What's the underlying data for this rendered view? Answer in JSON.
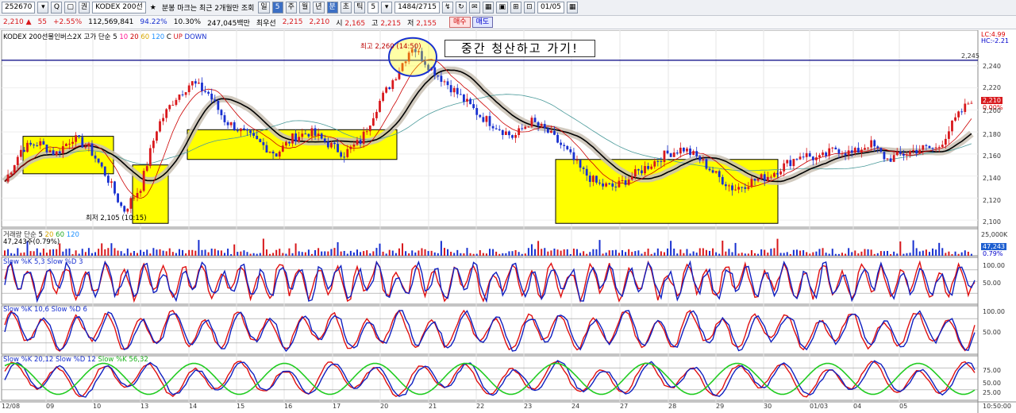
{
  "toolbar": {
    "code": "252670",
    "code_arrow": "▾",
    "search_glyph": "Q",
    "lock_glyph": "🔒",
    "flag": "권",
    "name": "KODEX 200선",
    "star": "★",
    "notice": "분봉 마크는 최근 2개월만 조회",
    "period_buttons": [
      "일",
      "5",
      "주",
      "월",
      "년",
      "분",
      "초",
      "틱"
    ],
    "interval_value": "5",
    "count": "1484/2715",
    "date": "01/05",
    "icon_buttons": [
      "↯",
      "↻",
      "✉",
      "▦",
      "▣",
      "⊞",
      "⊡"
    ]
  },
  "quote": {
    "price": "2,210",
    "arrow": "▲",
    "change": "55",
    "change_pct": "+2.55%",
    "volume": "112,569,841",
    "ratio1": "94.22%",
    "ratio2": "10.30%",
    "amount": "247,045백만",
    "best_ask_label": "최우선",
    "best_ask": "2,215",
    "best_bid": "2,210",
    "open_label": "시",
    "open": "2,165",
    "high_label": "고",
    "high": "2,215",
    "low_label": "저",
    "low": "2,155",
    "buy_label": "매수",
    "sell_label": "매도"
  },
  "main_panel": {
    "title": "KODEX 200선물인버스2X",
    "ma_legend_prefix": "고가 단순",
    "ma_periods": [
      "5",
      "10",
      "20",
      "60",
      "120"
    ],
    "ma_colors": [
      "#000000",
      "#ff1493",
      "#cc0000",
      "#d8a800",
      "#1e90ff"
    ],
    "extra_legend": [
      "C",
      "UP",
      "DOWN"
    ],
    "annotation_text": "중간 청산하고 가기!",
    "high_label": "최고 2,260 (14:50)",
    "low_label": "최저 2,105 (10:15)",
    "hline_value": "2,245",
    "current_price": "2,210",
    "current_pct": "0.00%",
    "lc_label": "LC:4.99",
    "hc_label": "HC:-2.21",
    "y_ticks": [
      "2,240",
      "2,220",
      "2,200",
      "2,180",
      "2,160",
      "2,140",
      "2,120",
      "2,100"
    ]
  },
  "volume_panel": {
    "title": "거래량 단순",
    "periods": [
      "5",
      "20",
      "60",
      "120"
    ],
    "value_label": "47,243주(0.79%)",
    "y_tick": "25,000K",
    "current": "47,243",
    "pct": "0.79%"
  },
  "stoch_panels": [
    {
      "title": "Slow %K 5,3  Slow %D 3",
      "ticks": [
        "100.00",
        "50.00"
      ]
    },
    {
      "title": "Slow %K 10,6  Slow %D 6",
      "ticks": [
        "100.00",
        "50.00"
      ]
    },
    {
      "title": "Slow %K 20,12  Slow %D 12",
      "extra": "Slow %K 56,32",
      "ticks": [
        "75.00",
        "50.00",
        "25.00"
      ]
    }
  ],
  "x_axis": [
    "12/08",
    "09",
    "10",
    "13",
    "14",
    "15",
    "16",
    "17",
    "20",
    "21",
    "22",
    "23",
    "24",
    "27",
    "28",
    "29",
    "30",
    "01/03",
    "04",
    "05"
  ],
  "time_label": "10:50:00",
  "colors": {
    "up": "#d8181c",
    "down": "#1830d0",
    "highlight": "#ffff00",
    "grid": "#cccccc",
    "hline": "#000080"
  },
  "chart_data": {
    "type": "candlestick",
    "x": [
      "12/08",
      "09",
      "10",
      "13",
      "14",
      "15",
      "16",
      "17",
      "20",
      "21",
      "22",
      "23",
      "24",
      "27",
      "28",
      "29",
      "30",
      "01/03",
      "04",
      "05"
    ],
    "close_path": [
      2135,
      2165,
      2170,
      2160,
      2175,
      2165,
      2140,
      2108,
      2130,
      2185,
      2210,
      2225,
      2215,
      2190,
      2180,
      2170,
      2160,
      2175,
      2180,
      2170,
      2160,
      2172,
      2205,
      2230,
      2258,
      2240,
      2225,
      2210,
      2195,
      2185,
      2175,
      2190,
      2180,
      2165,
      2145,
      2132,
      2130,
      2140,
      2150,
      2160,
      2165,
      2155,
      2140,
      2128,
      2135,
      2140,
      2150,
      2160,
      2155,
      2165,
      2160,
      2170,
      2155,
      2160,
      2165,
      2165,
      2190,
      2210
    ],
    "ylim": [
      2095,
      2268
    ],
    "high": 2260,
    "low": 2105,
    "reference_line": 2245
  }
}
